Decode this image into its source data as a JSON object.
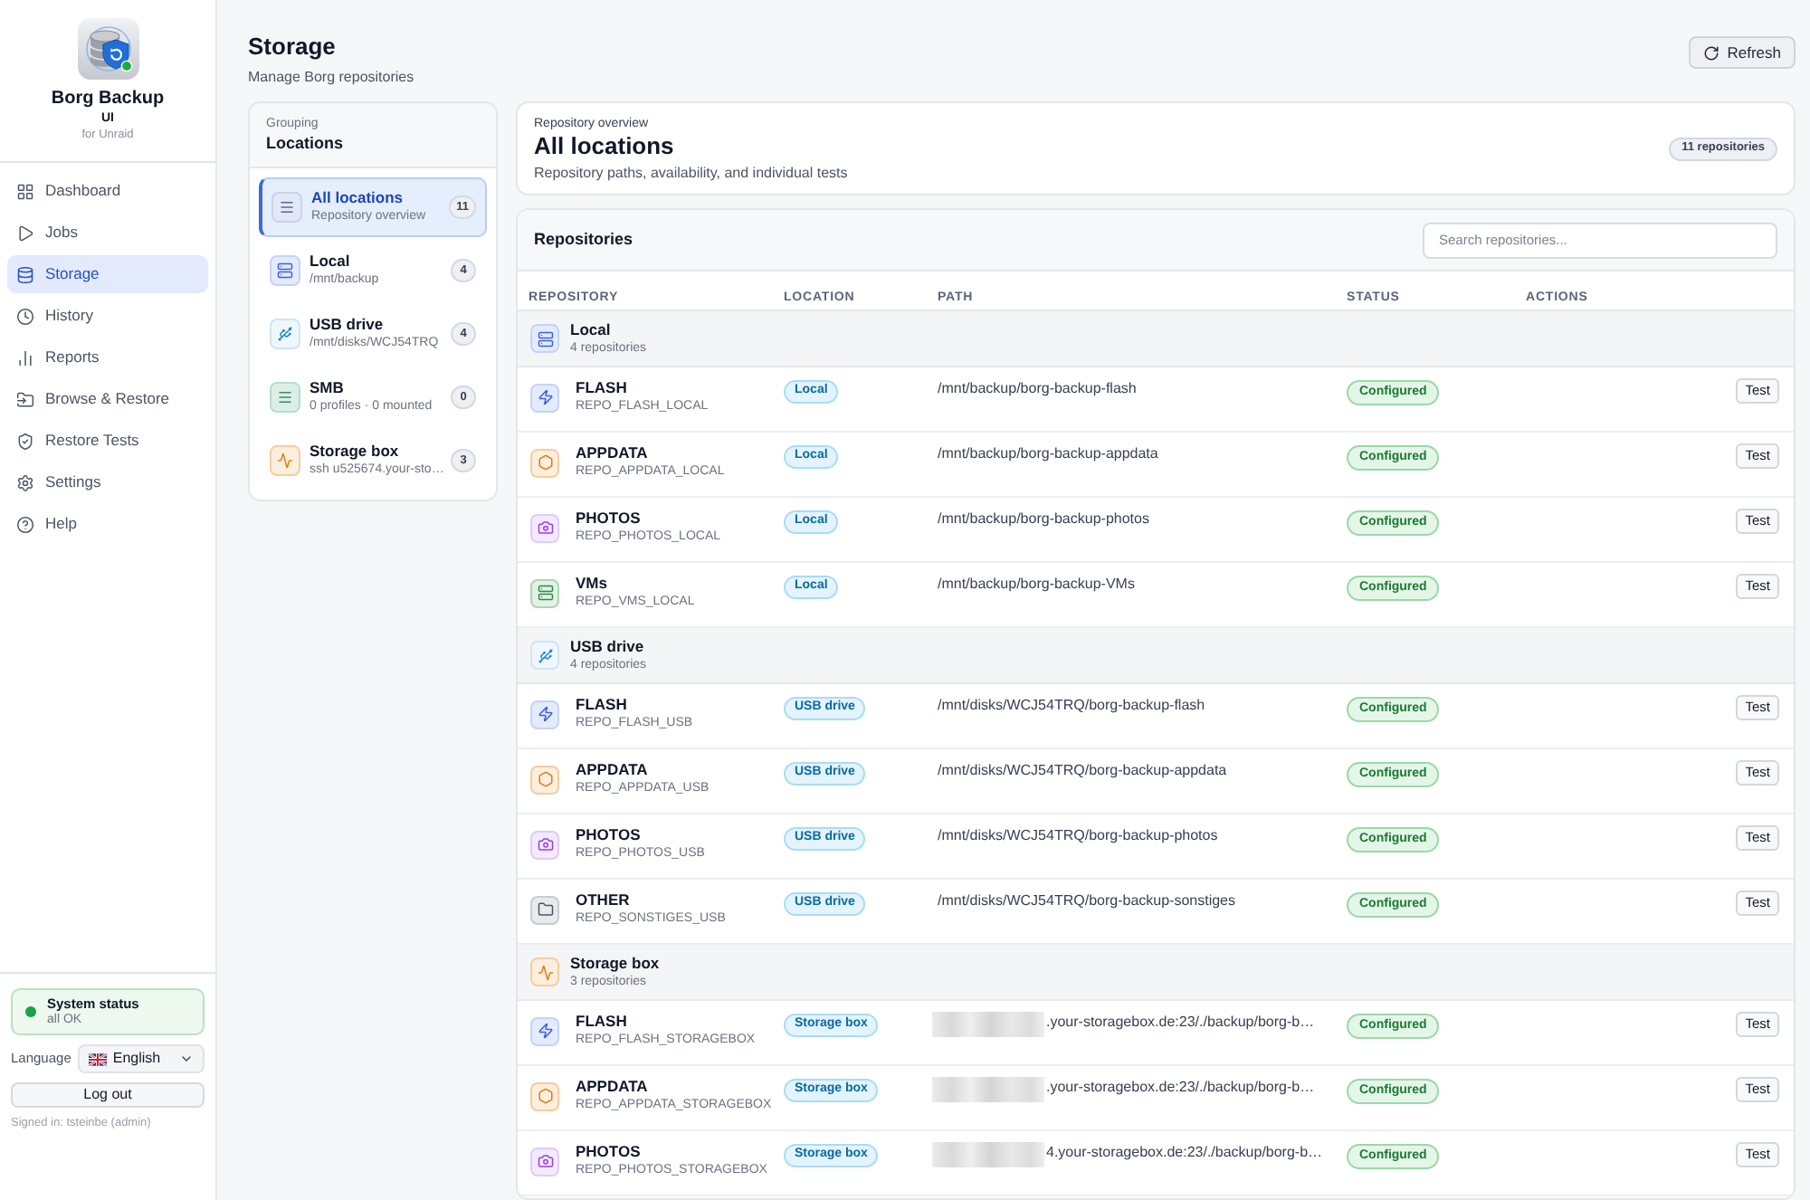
{
  "app": {
    "name": "Borg Backup",
    "subtitle": "UI",
    "tagline": "for Unraid"
  },
  "nav": [
    {
      "kind": "dashboard",
      "label": "Dashboard",
      "selected": false
    },
    {
      "kind": "jobs",
      "label": "Jobs",
      "selected": false
    },
    {
      "kind": "storage",
      "label": "Storage",
      "selected": true
    },
    {
      "kind": "history",
      "label": "History",
      "selected": false
    },
    {
      "kind": "reports",
      "label": "Reports",
      "selected": false
    },
    {
      "kind": "browse",
      "label": "Browse & Restore",
      "selected": false
    },
    {
      "kind": "restore_tests",
      "label": "Restore Tests",
      "selected": false
    },
    {
      "kind": "settings",
      "label": "Settings",
      "selected": false
    },
    {
      "kind": "help",
      "label": "Help",
      "selected": false
    }
  ],
  "system_status": {
    "title": "System status",
    "detail": "all OK",
    "ok": true
  },
  "language": {
    "label": "Language",
    "value": "English"
  },
  "logout": "Log out",
  "signed_in": "Signed in: tsteinbe (admin)",
  "header": {
    "title": "Storage",
    "subtitle": "Manage Borg repositories",
    "refresh": "Refresh"
  },
  "locations": {
    "eyebrow": "Grouping",
    "title": "Locations",
    "items": [
      {
        "kind": "all",
        "name": "All locations",
        "detail": "Repository overview",
        "count": "11",
        "selected": true
      },
      {
        "kind": "local",
        "name": "Local",
        "detail": "/mnt/backup",
        "count": "4",
        "selected": false
      },
      {
        "kind": "usb",
        "name": "USB drive",
        "detail": "/mnt/disks/WCJ54TRQ",
        "count": "4",
        "selected": false
      },
      {
        "kind": "smb",
        "name": "SMB",
        "detail": "0 profiles · 0 mounted",
        "count": "0",
        "selected": false
      },
      {
        "kind": "storagebox",
        "name": "Storage box",
        "detail": "ssh u525674.your-sto…",
        "count": "3",
        "selected": false
      }
    ]
  },
  "overview": {
    "eyebrow": "Repository overview",
    "title": "All locations",
    "description": "Repository paths, availability, and individual tests",
    "badge": "11 repositories"
  },
  "repositories": {
    "title": "Repositories",
    "search_placeholder": "Search repositories...",
    "columns": [
      "REPOSITORY",
      "LOCATION",
      "PATH",
      "STATUS",
      "ACTIONS"
    ],
    "groups": [
      {
        "kind": "local",
        "name": "Local",
        "count": "4 repositories",
        "rows": [
          {
            "kind": "flash",
            "name": "FLASH",
            "repo_key": "REPO_FLASH_LOCAL",
            "location": "Local",
            "path": "/mnt/backup/borg-backup-flash",
            "redacted": false,
            "status": "Configured",
            "action": "Test"
          },
          {
            "kind": "appdata",
            "name": "APPDATA",
            "repo_key": "REPO_APPDATA_LOCAL",
            "location": "Local",
            "path": "/mnt/backup/borg-backup-appdata",
            "redacted": false,
            "status": "Configured",
            "action": "Test"
          },
          {
            "kind": "photos",
            "name": "PHOTOS",
            "repo_key": "REPO_PHOTOS_LOCAL",
            "location": "Local",
            "path": "/mnt/backup/borg-backup-photos",
            "redacted": false,
            "status": "Configured",
            "action": "Test"
          },
          {
            "kind": "vms",
            "name": "VMs",
            "repo_key": "REPO_VMS_LOCAL",
            "location": "Local",
            "path": "/mnt/backup/borg-backup-VMs",
            "redacted": false,
            "status": "Configured",
            "action": "Test"
          }
        ]
      },
      {
        "kind": "usb",
        "name": "USB drive",
        "count": "4 repositories",
        "rows": [
          {
            "kind": "flash",
            "name": "FLASH",
            "repo_key": "REPO_FLASH_USB",
            "location": "USB drive",
            "path": "/mnt/disks/WCJ54TRQ/borg-backup-flash",
            "redacted": false,
            "status": "Configured",
            "action": "Test"
          },
          {
            "kind": "appdata",
            "name": "APPDATA",
            "repo_key": "REPO_APPDATA_USB",
            "location": "USB drive",
            "path": "/mnt/disks/WCJ54TRQ/borg-backup-appdata",
            "redacted": false,
            "status": "Configured",
            "action": "Test"
          },
          {
            "kind": "photos",
            "name": "PHOTOS",
            "repo_key": "REPO_PHOTOS_USB",
            "location": "USB drive",
            "path": "/mnt/disks/WCJ54TRQ/borg-backup-photos",
            "redacted": false,
            "status": "Configured",
            "action": "Test"
          },
          {
            "kind": "other",
            "name": "OTHER",
            "repo_key": "REPO_SONSTIGES_USB",
            "location": "USB drive",
            "path": "/mnt/disks/WCJ54TRQ/borg-backup-sonstiges",
            "redacted": false,
            "status": "Configured",
            "action": "Test"
          }
        ]
      },
      {
        "kind": "storagebox",
        "name": "Storage box",
        "count": "3 repositories",
        "rows": [
          {
            "kind": "flash",
            "name": "FLASH",
            "repo_key": "REPO_FLASH_STORAGEBOX",
            "location": "Storage box",
            "path": ".your-storagebox.de:23/./backup/borg-b…",
            "redacted": true,
            "status": "Configured",
            "action": "Test"
          },
          {
            "kind": "appdata",
            "name": "APPDATA",
            "repo_key": "REPO_APPDATA_STORAGEBOX",
            "location": "Storage box",
            "path": ".your-storagebox.de:23/./backup/borg-b…",
            "redacted": true,
            "status": "Configured",
            "action": "Test"
          },
          {
            "kind": "photos",
            "name": "PHOTOS",
            "repo_key": "REPO_PHOTOS_STORAGEBOX",
            "location": "Storage box",
            "path": "4.your-storagebox.de:23/./backup/borg-b…",
            "redacted": true,
            "status": "Configured",
            "action": "Test"
          }
        ]
      }
    ]
  }
}
